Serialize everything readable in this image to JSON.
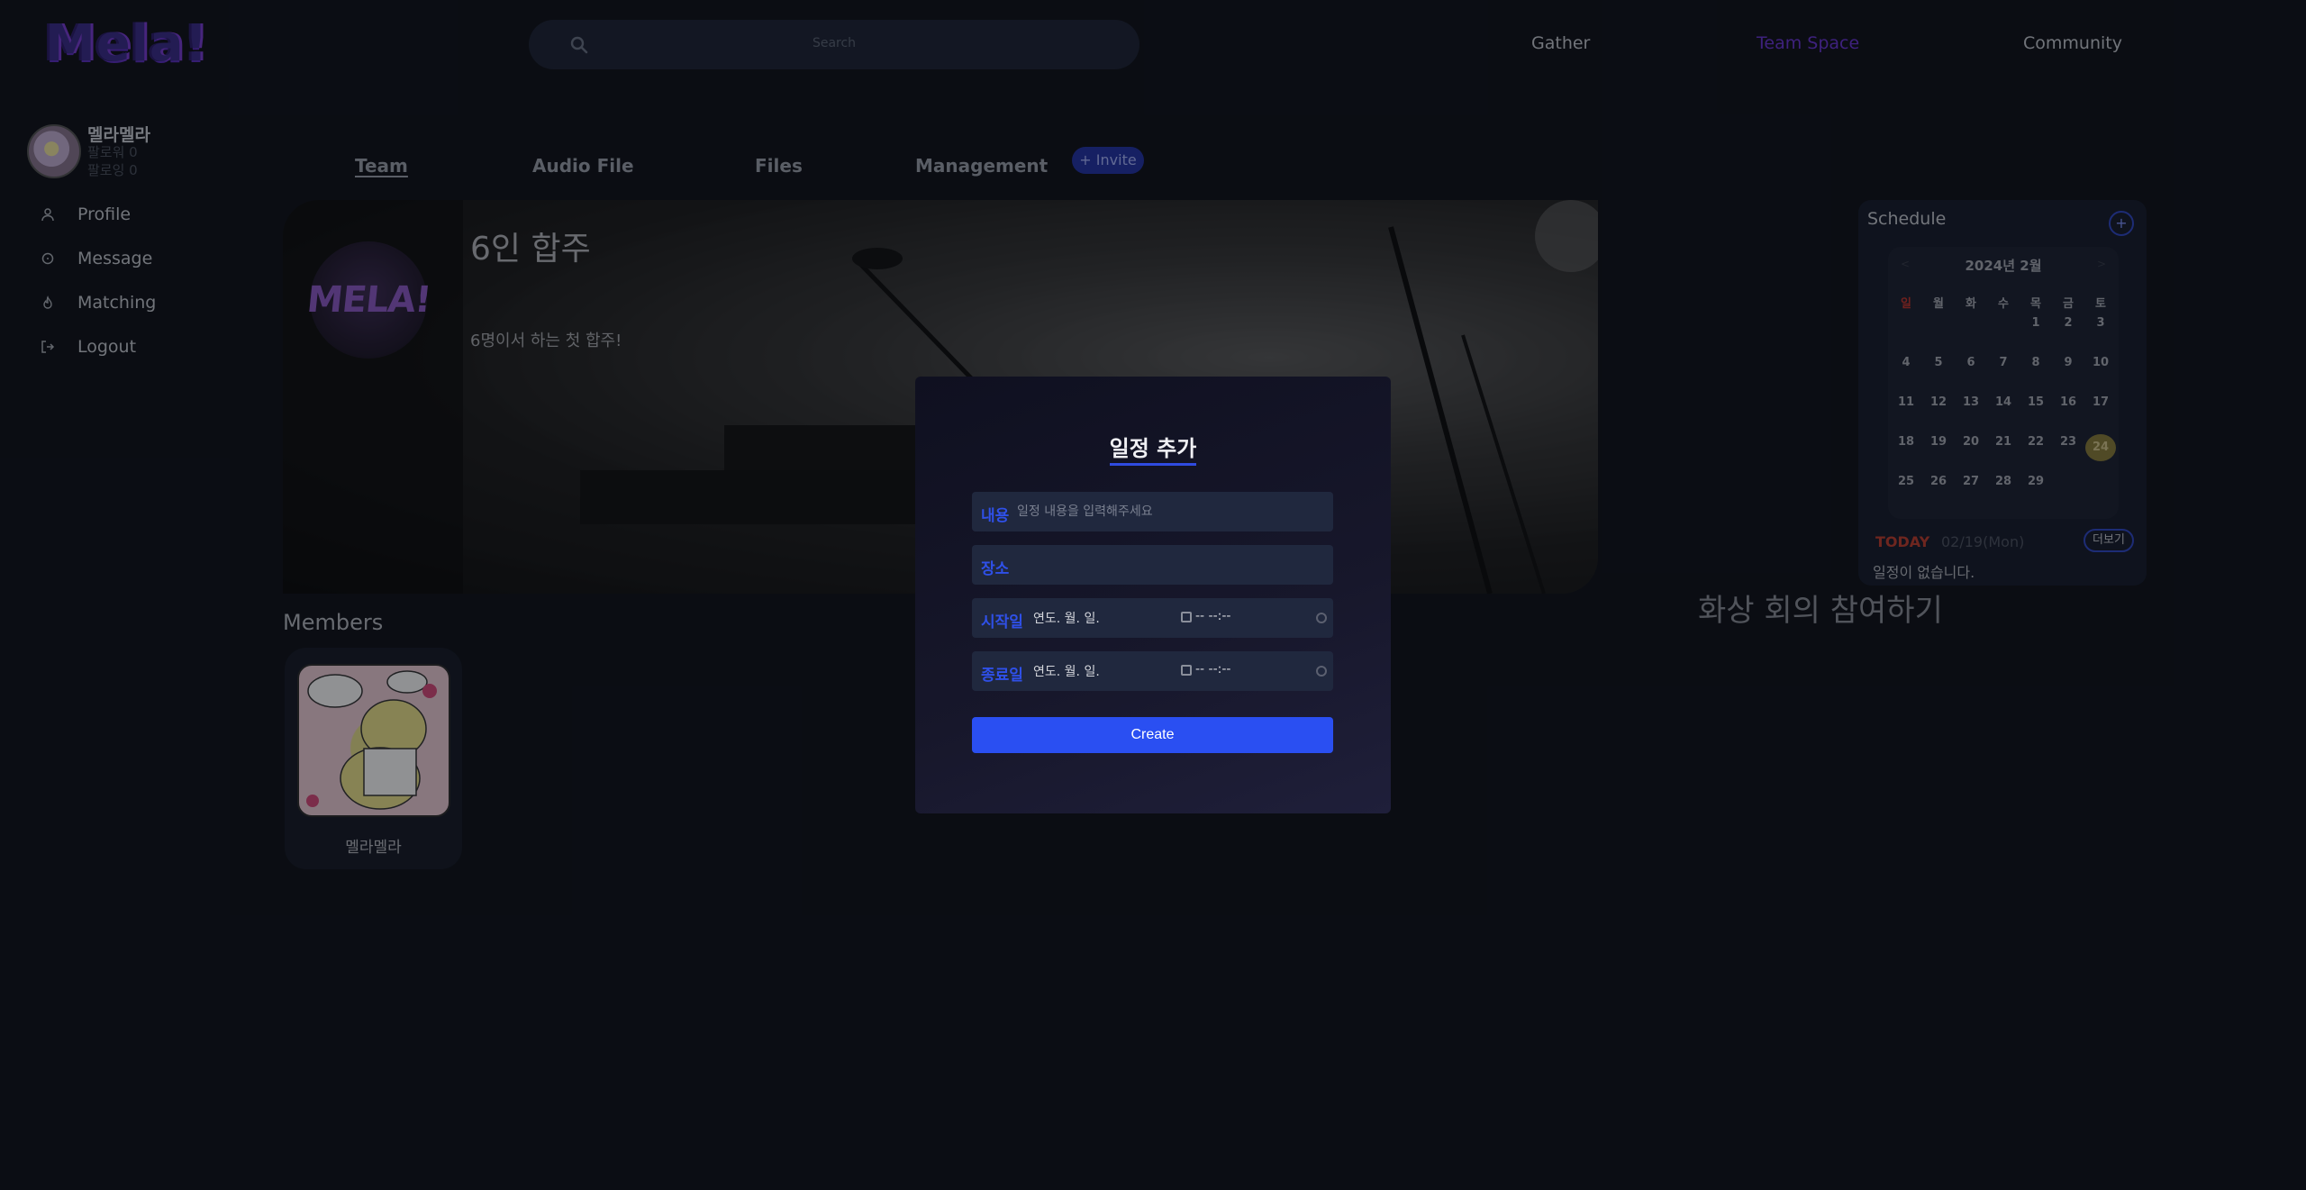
{
  "header": {
    "logo_text": "Mela!",
    "search_placeholder": "Search",
    "nav": [
      "Gather",
      "Team Space",
      "Community"
    ]
  },
  "profile": {
    "username": "멜라멜라",
    "followers": "팔로워 0",
    "following": "팔로잉 0"
  },
  "sidebar": {
    "items": [
      {
        "label": "Profile",
        "icon": "user-icon"
      },
      {
        "label": "Message",
        "icon": "message-icon"
      },
      {
        "label": "Matching",
        "icon": "fire-icon"
      },
      {
        "label": "Logout",
        "icon": "logout-icon"
      }
    ]
  },
  "tabs": {
    "items": [
      "Team",
      "Audio File",
      "Files",
      "Management"
    ],
    "active": "Team",
    "invite_label": "+ Invite"
  },
  "team": {
    "logo_text": "MELA!",
    "name": "6인 합주",
    "description": "6명이서 하는 첫 합주!"
  },
  "members": {
    "title": "Members",
    "list": [
      {
        "name": "멜라멜라"
      }
    ]
  },
  "schedule": {
    "title": "Schedule",
    "add_label": "+",
    "calendar_title": "2024년 2월",
    "prev": "<",
    "next": ">",
    "weekdays": [
      "일",
      "월",
      "화",
      "수",
      "목",
      "금",
      "토"
    ],
    "days": [
      "",
      "",
      "",
      "",
      1,
      2,
      3,
      4,
      5,
      6,
      7,
      8,
      9,
      10,
      11,
      12,
      13,
      14,
      15,
      16,
      17,
      18,
      19,
      20,
      21,
      22,
      23,
      24,
      25,
      26,
      27,
      28,
      29
    ],
    "today_day": 24,
    "today_label": "TODAY",
    "today_date": "02/19(Mon)",
    "more_label": "더보기",
    "empty_text": "일정이 없습니다."
  },
  "video_join": "화상 회의 참여하기",
  "modal": {
    "title": "일정 추가",
    "content_label": "내용",
    "content_placeholder": "일정 내용을 입력해주세요",
    "location_label": "장소",
    "start_label": "시작일",
    "end_label": "종료일",
    "date_placeholder": "연도. 월. 일.",
    "time_placeholder": "-- --:--",
    "create_label": "Create"
  },
  "colors": {
    "background": "#0d1017",
    "accent": "#2a4ff2",
    "active_nav": "#6a34d8",
    "today": "#c23c2c"
  }
}
